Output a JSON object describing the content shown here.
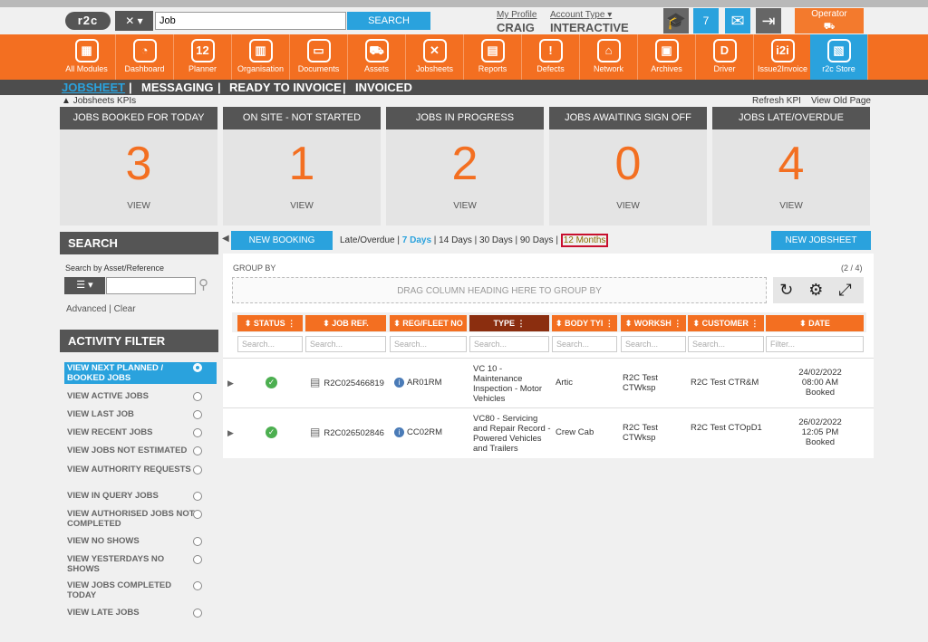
{
  "header": {
    "logo_text": "r2c",
    "tools_glyph": "✕ ▾",
    "search_value": "Job",
    "search_button": "SEARCH",
    "profile_link": "My Profile",
    "profile_name": "CRAIG",
    "account_link": "Account Type ▾",
    "account_type": "INTERACTIVE",
    "notification_count": "7",
    "operator_label": "Operator"
  },
  "nav": {
    "items": [
      {
        "label": "All Modules",
        "icon": "▦"
      },
      {
        "label": "Dashboard",
        "icon": "◔"
      },
      {
        "label": "Planner",
        "icon": "12"
      },
      {
        "label": "Organisation",
        "icon": "▥"
      },
      {
        "label": "Documents",
        "icon": "▭"
      },
      {
        "label": "Assets",
        "icon": "⛟"
      },
      {
        "label": "Jobsheets",
        "icon": "✕"
      },
      {
        "label": "Reports",
        "icon": "▤"
      },
      {
        "label": "Defects",
        "icon": "!"
      },
      {
        "label": "Network",
        "icon": "⌂"
      },
      {
        "label": "Archives",
        "icon": "▣"
      },
      {
        "label": "Driver",
        "icon": "D"
      },
      {
        "label": "Issue2Invoice",
        "icon": "i2i"
      },
      {
        "label": "r2c Store",
        "icon": "▧"
      }
    ]
  },
  "tabs": {
    "jobsheet": "JOBSHEET",
    "messaging": "MESSAGING",
    "ready": "READY TO INVOICE",
    "invoiced": "INVOICED",
    "sep": "|"
  },
  "kpi": {
    "toggle": "Jobsheets KPIs",
    "refresh": "Refresh KPI",
    "view_old": "View Old Page",
    "cards": [
      {
        "title": "JOBS BOOKED FOR TODAY",
        "value": "3",
        "action": "VIEW"
      },
      {
        "title": "ON SITE - NOT STARTED",
        "value": "1",
        "action": "VIEW"
      },
      {
        "title": "JOBS IN PROGRESS",
        "value": "2",
        "action": "VIEW"
      },
      {
        "title": "JOBS AWAITING SIGN OFF",
        "value": "0",
        "action": "VIEW"
      },
      {
        "title": "JOBS LATE/OVERDUE",
        "value": "4",
        "action": "VIEW"
      }
    ]
  },
  "search_panel": {
    "title": "SEARCH",
    "label": "Search by Asset/Reference",
    "advanced": "Advanced",
    "clear": "Clear",
    "sep": "|"
  },
  "activity": {
    "title": "ACTIVITY FILTER",
    "items": [
      "VIEW NEXT PLANNED / BOOKED JOBS",
      "VIEW ACTIVE JOBS",
      "VIEW LAST JOB",
      "VIEW RECENT JOBS",
      "VIEW JOBS NOT ESTIMATED",
      "VIEW AUTHORITY REQUESTS",
      "VIEW IN QUERY JOBS",
      "VIEW AUTHORISED JOBS NOT COMPLETED",
      "VIEW NO SHOWS",
      "VIEW YESTERDAYS NO SHOWS",
      "VIEW JOBS COMPLETED TODAY",
      "VIEW LATE JOBS"
    ]
  },
  "toolbar": {
    "new_booking": "NEW BOOKING",
    "new_jobsheet": "NEW JOBSHEET",
    "ranges": [
      "Late/Overdue",
      "7 Days",
      "14 Days",
      "30 Days",
      "90 Days",
      "12 Months"
    ],
    "sep": "|"
  },
  "grid": {
    "group_by": "GROUP BY",
    "page_count": "(2 / 4)",
    "drop_hint": "DRAG COLUMN HEADING HERE TO GROUP BY",
    "tools": "↻ ⚙ ⤢",
    "columns": [
      {
        "label": "⬍ STATUS ⋮",
        "filter": "Search..."
      },
      {
        "label": "⬍ JOB REF.",
        "filter": "Search..."
      },
      {
        "label": "⬍ REG/FLEET NO",
        "filter": "Search..."
      },
      {
        "label": "TYPE ⋮",
        "filter": "Search..."
      },
      {
        "label": "⬍ BODY TYI ⋮",
        "filter": "Search..."
      },
      {
        "label": "⬍ WORKSH ⋮",
        "filter": "Search..."
      },
      {
        "label": "⬍ CUSTOMER ⋮",
        "filter": "Search..."
      },
      {
        "label": "⬍ DATE",
        "filter": "Filter..."
      }
    ],
    "rows": [
      {
        "status": "✓",
        "job_ref": "R2C025466819",
        "reg": "AR01RM",
        "type": "VC 10 - Maintenance Inspection - Motor Vehicles",
        "body": "Artic",
        "workshop": "R2C Test CTWksp",
        "customer": "R2C Test CTR&M",
        "date": "24/02/2022",
        "time": "08:00 AM",
        "state": "Booked"
      },
      {
        "status": "✓",
        "job_ref": "R2C026502846",
        "reg": "CC02RM",
        "type": "VC80 - Servicing and Repair Record - Powered Vehicles and Trailers",
        "body": "Crew Cab",
        "workshop": "R2C Test CTWksp",
        "customer": "R2C Test CTOpD1",
        "date": "26/02/2022",
        "time": "12:05 PM",
        "state": "Booked"
      }
    ]
  }
}
